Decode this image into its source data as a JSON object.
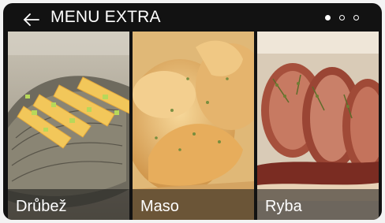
{
  "header": {
    "title": "MENU EXTRA",
    "back_icon": "arrow-left-icon",
    "page_indicator": {
      "total": 3,
      "current": 1
    }
  },
  "tiles": [
    {
      "label": "Drůbež",
      "image": "baked-fish-with-lemon-and-herbs"
    },
    {
      "label": "Maso",
      "image": "roasted-chicken-legs"
    },
    {
      "label": "Ryba",
      "image": "sliced-roast-meat-with-thyme"
    }
  ]
}
